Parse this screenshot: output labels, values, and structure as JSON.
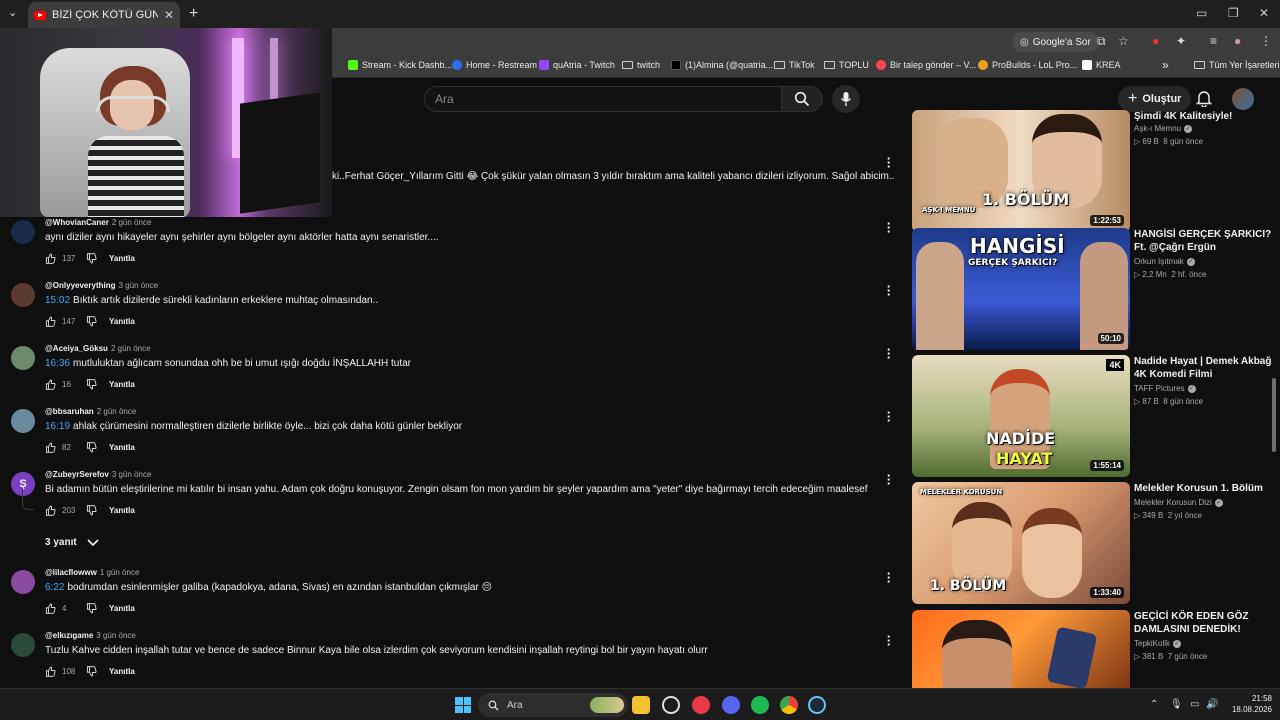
{
  "browser": {
    "tab_title": "BİZİ ÇOK KÖTÜ GÜNLER BEKLİYOR",
    "new_tab": "+",
    "google_sor": "Google'a Sor",
    "bookmarks": [
      {
        "label": "Stream - Kick Dashb...",
        "color": "#53fc18"
      },
      {
        "label": "Home - Restream",
        "color": "#2e6ff2"
      },
      {
        "label": "quAtria - Twitch",
        "color": "#9146ff"
      },
      {
        "label": "twitch",
        "color": "folder"
      },
      {
        "label": "(1)Almina (@quatria...",
        "color": "#000000"
      },
      {
        "label": "TikTok",
        "color": "folder"
      },
      {
        "label": "TOPLU",
        "color": "folder"
      },
      {
        "label": "Bir talep gönder – V...",
        "color": "#ff4655"
      },
      {
        "label": "ProBuilds - LoL Pro...",
        "color": "#f0a020"
      },
      {
        "label": "KREA",
        "color": "#ffffff"
      }
    ],
    "all_bookmarks": "Tüm Yer İşaretleri"
  },
  "youtube": {
    "search_placeholder": "Ara",
    "create_label": "Oluştur"
  },
  "comments": {
    "first_partial_text": "ki..Ferhat Göçer_Yıllarım Gitti 😂 Çok şükür yalan olmasın 3 yıldır bıraktım ama kaliteli yabancı dizileri izliyorum. Sağol abicim..",
    "reply_label": "Yanıtla",
    "replies_toggle": "3 yanıt",
    "items": [
      {
        "author": "@WhovianCaner",
        "date": "2 gün önce",
        "timestamp": "",
        "text": "aynı diziler aynı hikayeler aynı şehirler aynı bölgeler aynı aktörler hatta aynı senaristler....",
        "likes": "137",
        "avatar": "#1a2a4a"
      },
      {
        "author": "@Onlyyeverything",
        "date": "3 gün önce",
        "timestamp": "15:02",
        "text": "Bıktık artık dizilerde sürekli kadınların erkeklere muhtaç olmasından..",
        "likes": "147",
        "avatar": "#5a3a2e"
      },
      {
        "author": "@Aceiya_Göksu",
        "date": "2 gün önce",
        "timestamp": "16:36",
        "text": "mutluluktan ağlıcam sonundaa ohh be bi umut ışığı doğdu İNŞALLAHH tutar",
        "likes": "16",
        "avatar": "#6a8a6a"
      },
      {
        "author": "@bbsaruhan",
        "date": "2 gün önce",
        "timestamp": "16:19",
        "text": "ahlak çürümesini normalleştiren dizilerle birlikte öyle... bizi çok daha kötü günler bekliyor",
        "likes": "82",
        "avatar": "#6a8aa0"
      },
      {
        "author": "@ZubeyrSerefov",
        "date": "3 gün önce",
        "timestamp": "",
        "text": "Bi adamın bütün eleştirilerine mi katılır bi insan yahu. Adam çok doğru konuşuyor. Zengin olsam fon mon yardım bir şeyler yapardım ama \"yeter\" diye bağırmayı tercih edeceğim maalesef",
        "likes": "203",
        "avatar": "#7b3fc4",
        "initial": "Ş"
      },
      {
        "author": "@lilacflowww",
        "date": "1 gün önce",
        "timestamp": "6:22",
        "text": "bodrumdan esinlenmişler galiba (kapadokya, adana, Sivas) en azından istanbuldan çıkmışlar 😔",
        "likes": "4",
        "avatar": "#8a4aa0"
      },
      {
        "author": "@elkızıgame",
        "date": "3 gün önce",
        "timestamp": "",
        "text": "Tuzlu Kahve cidden inşallah tutar ve bence de sadece Binnur Kaya bile olsa izlerdim çok seviyorum kendisini inşallah reytingi bol bir yayın hayatı olurr",
        "likes": "108",
        "avatar": "#2a4a3a"
      }
    ]
  },
  "related": [
    {
      "title": "Şimdi 4K Kalitesiyle!",
      "channel": "Aşk-ı Memnu",
      "verified": true,
      "views": "69 B",
      "age": "8 gün önce",
      "duration": "1:22:53",
      "thumb_text": "1. BÖLÜM",
      "thumb_sub": "AŞK-I MEMNU"
    },
    {
      "title": "HANGİSİ GERÇEK ŞARKICI? Ft. @Çağrı Ergün",
      "channel": "Orkun Işıtmak",
      "verified": true,
      "views": "2,2 Mn",
      "age": "2 hf. önce",
      "duration": "50:10",
      "thumb_text": "HANGİSİ",
      "thumb_sub": "GERÇEK ŞARKICI?"
    },
    {
      "title": "Nadide Hayat | Demek Akbağ 4K Komedi Filmi",
      "channel": "TAFF Pictures",
      "verified": true,
      "views": "87 B",
      "age": "8 gün önce",
      "duration": "1:55:14",
      "thumb_text": "NADİDE",
      "thumb_sub": "HAYAT"
    },
    {
      "title": "Melekler Korusun 1. Bölüm",
      "channel": "Melekler Korusun Dizi",
      "verified": true,
      "views": "349 B",
      "age": "2 yıl önce",
      "duration": "1:33:40",
      "thumb_text": "1. BÖLÜM",
      "thumb_sub": "MELEKLER KORUSUN"
    },
    {
      "title": "GEÇİCİ KÖR EDEN GÖZ DAMLASINI DENEDİK!",
      "channel": "TepkiKolik",
      "verified": true,
      "views": "381 B",
      "age": "7 gün önce",
      "duration": "",
      "thumb_text": "",
      "thumb_sub": ""
    }
  ],
  "taskbar": {
    "search": "Ara",
    "time": "21:58",
    "date": "18.08.2026"
  }
}
